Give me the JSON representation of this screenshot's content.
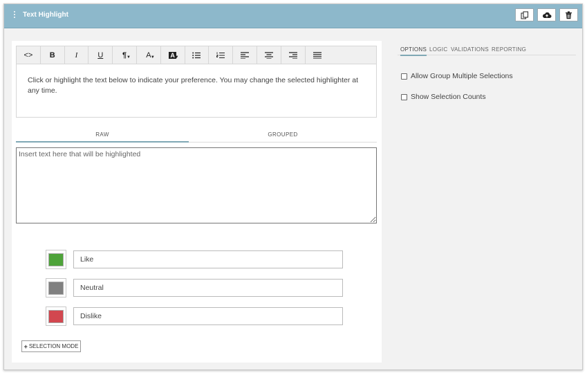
{
  "header": {
    "title": "Text Highlight",
    "buttons": {
      "copy_icon": "copy-icon",
      "upload_icon": "cloud-upload-icon",
      "delete_icon": "trash-icon"
    }
  },
  "toolbar": {
    "code": "<>",
    "bold": "B",
    "italic": "I",
    "underline": "U",
    "paragraph": "¶",
    "font_color": "A",
    "bg_color": "A"
  },
  "editor": {
    "text": "Click or highlight the text below to indicate your preference. You may change the selected highlighter at any time."
  },
  "mode_tabs": {
    "raw": "RAW",
    "grouped": "GROUPED"
  },
  "raw_textarea": {
    "placeholder": "Insert text here that will be highlighted"
  },
  "highlighters": [
    {
      "label": "Like",
      "color": "#4ea33a"
    },
    {
      "label": "Neutral",
      "color": "#808080"
    },
    {
      "label": "Dislike",
      "color": "#d2474f"
    }
  ],
  "selection_mode": {
    "label": "SELECTION MODE",
    "prefix": "+"
  },
  "right_panel": {
    "tabs": [
      "OPTIONS",
      "LOGIC",
      "VALIDATIONS",
      "REPORTING"
    ],
    "options": [
      "Allow Group Multiple Selections",
      "Show Selection Counts"
    ]
  },
  "colors": {
    "header_bg": "#8db8cb",
    "accent": "#7fa8b5"
  }
}
